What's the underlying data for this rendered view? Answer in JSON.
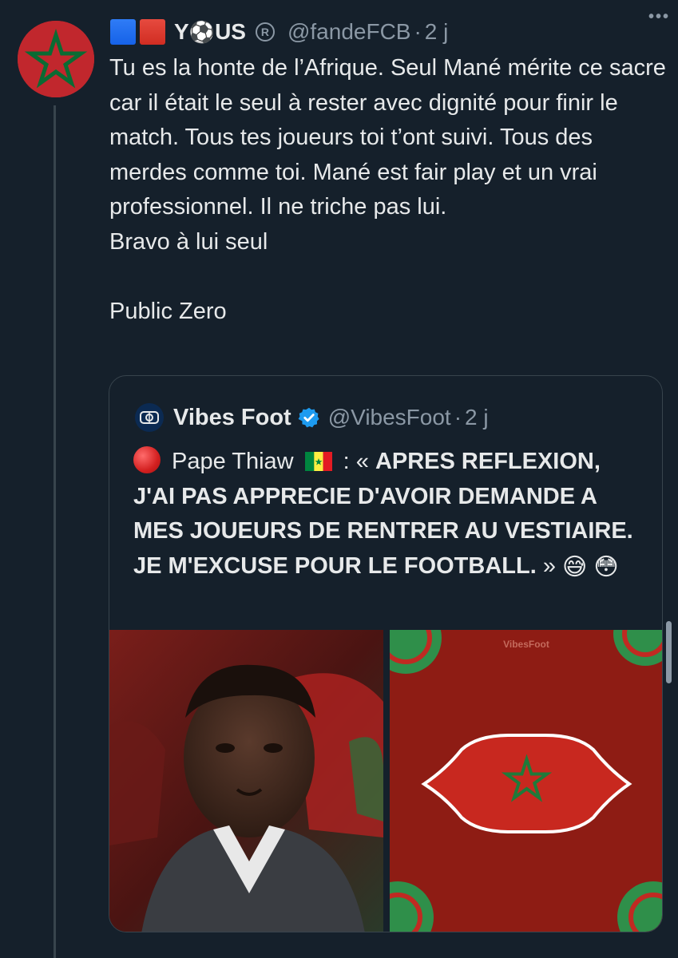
{
  "tweet": {
    "flags": [
      "blue-square",
      "red-square"
    ],
    "display_name_prefix": "Y",
    "display_name_emoji": "⚽",
    "display_name_suffix": "US",
    "registered_mark": "R",
    "handle": "@fandeFCB",
    "separator": "·",
    "time": "2 j",
    "more_label": "•••",
    "text": "Tu es la honte de l’Afrique. Seul Mané mérite ce sacre car il était le seul à rester avec dignité pour finir le match. Tous tes joueurs toi t’ont suivi. Tous des merdes comme toi. Mané est fair play et un vrai professionnel. Il ne triche pas lui.\nBravo à lui seul\n\nPublic Zero"
  },
  "quote": {
    "name": "Vibes Foot",
    "handle": "@VibesFoot",
    "separator": "·",
    "time": "2 j",
    "lead_name": "Pape Thiaw",
    "lead_colon": ": «",
    "bold_text": "APRES REFLEXION, J'AI PAS APPRECIE D'AVOIR DEMANDE A MES JOUEURS DE RENTRER AU VESTIAIRE. JE M'EXCUSE POUR LE FOOTBALL.",
    "closing": "»",
    "emoji_1": "😅",
    "emoji_2": "😳",
    "watermark": "VibesFoot"
  },
  "colors": {
    "background": "#15202b",
    "text": "#e7e9ea",
    "secondary": "#8b98a5",
    "border": "#38444d",
    "verified": "#1d9bf0",
    "morocco_red": "#c1272d",
    "morocco_green": "#006233"
  }
}
